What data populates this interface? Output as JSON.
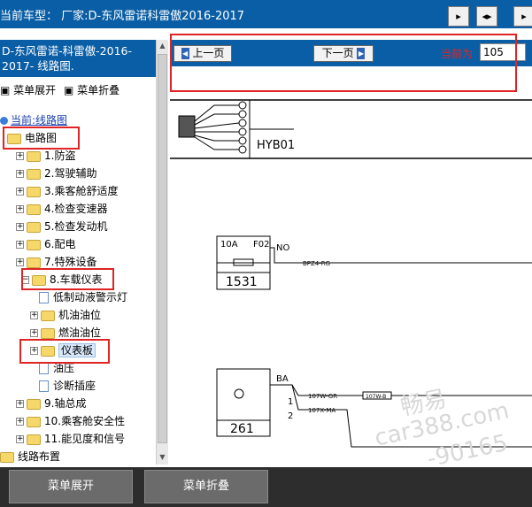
{
  "top": {
    "title": "当前车型： 厂家:D-东风雷诺科雷傲2016-2017",
    "buttons": [
      "▸",
      "◂▸",
      "▸"
    ]
  },
  "left": {
    "header": "D-东风雷诺-科雷傲-2016-2017- 线路图.",
    "expand_label": "菜单展开",
    "collapse_label": "菜单折叠",
    "current_label": "当前:线路图",
    "tree": [
      {
        "label": "电路图",
        "kind": "folder-open"
      },
      {
        "label": "1.防盗",
        "kind": "folder"
      },
      {
        "label": "2.驾驶辅助",
        "kind": "folder"
      },
      {
        "label": "3.乘客舱舒适度",
        "kind": "folder"
      },
      {
        "label": "4.检查变速器",
        "kind": "folder"
      },
      {
        "label": "5.检查发动机",
        "kind": "folder"
      },
      {
        "label": "6.配电",
        "kind": "folder"
      },
      {
        "label": "7.特殊设备",
        "kind": "folder"
      },
      {
        "label": "8.车载仪表",
        "kind": "folder-open"
      },
      {
        "label": "低制动液警示灯",
        "kind": "page"
      },
      {
        "label": "机油油位",
        "kind": "folder"
      },
      {
        "label": "燃油油位",
        "kind": "folder"
      },
      {
        "label": "仪表板",
        "kind": "folder-selected"
      },
      {
        "label": "油压",
        "kind": "page"
      },
      {
        "label": "诊断插座",
        "kind": "page"
      },
      {
        "label": "9.轴总成",
        "kind": "folder"
      },
      {
        "label": "10.乘客舱安全性",
        "kind": "folder"
      },
      {
        "label": "11.能见度和信号",
        "kind": "folder"
      },
      {
        "label": "线路布置",
        "kind": "folder"
      }
    ]
  },
  "bottom": {
    "expand_label": "菜单展开",
    "collapse_label": "菜单折叠"
  },
  "viewer": {
    "prev_label": "上一页",
    "next_label": "下一页",
    "current_label": "当前为",
    "page_value": "105",
    "connector_code": "HYB01",
    "fuse": {
      "rating": "10A",
      "id": "F02",
      "number": "1531",
      "pin": "NO",
      "wire": "BPZ4-RG"
    },
    "relay": {
      "number": "261",
      "pin": "BA",
      "pin1": "1",
      "pin2": "2",
      "wire1": "107W-GR",
      "wire2": "107X-MA",
      "mid_label": "107W-B"
    },
    "watermark1": "畅易",
    "watermark2": "car388.com",
    "watermark3": "-90165"
  }
}
